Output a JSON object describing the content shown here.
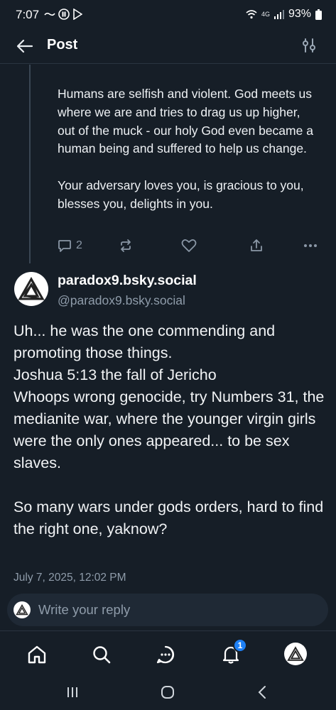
{
  "status_bar": {
    "time": "7:07",
    "network_label": "4G",
    "battery_percent": "93%"
  },
  "header": {
    "title": "Post"
  },
  "parent_post": {
    "text": "Humans are selfish and violent. God meets us where we are and tries to drag us up higher, out of the muck - our holy God even became a human being and suffered to help us change.\n\nYour adversary loves you, is gracious to you, blesses you, delights in you.",
    "reply_count": "2"
  },
  "reply_post": {
    "display_name": "paradox9.bsky.social",
    "handle": "@paradox9.bsky.social",
    "text": "Uh... he was the one commending and promoting those things.\nJoshua 5:13 the fall of Jericho\nWhoops wrong genocide, try Numbers 31, the medianite war, where the younger virgin girls were the only ones appeared... to be sex slaves.\n\nSo many wars under gods orders, hard to find the right one, yaknow?",
    "timestamp": "July 7, 2025, 12:02 PM"
  },
  "composer": {
    "placeholder": "Write your reply"
  },
  "bottom_nav": {
    "notification_count": "1"
  },
  "colors": {
    "background": "#161e27",
    "text": "#f1f3f5",
    "muted": "#8f9caa",
    "accent": "#1e80f5"
  },
  "icons": [
    "back-arrow-icon",
    "sliders-icon",
    "reply-icon",
    "repost-icon",
    "like-icon",
    "share-icon",
    "more-icon",
    "home-icon",
    "search-icon",
    "chat-icon",
    "bell-icon",
    "recents-icon",
    "home-circle-icon",
    "back-chevron-icon"
  ]
}
